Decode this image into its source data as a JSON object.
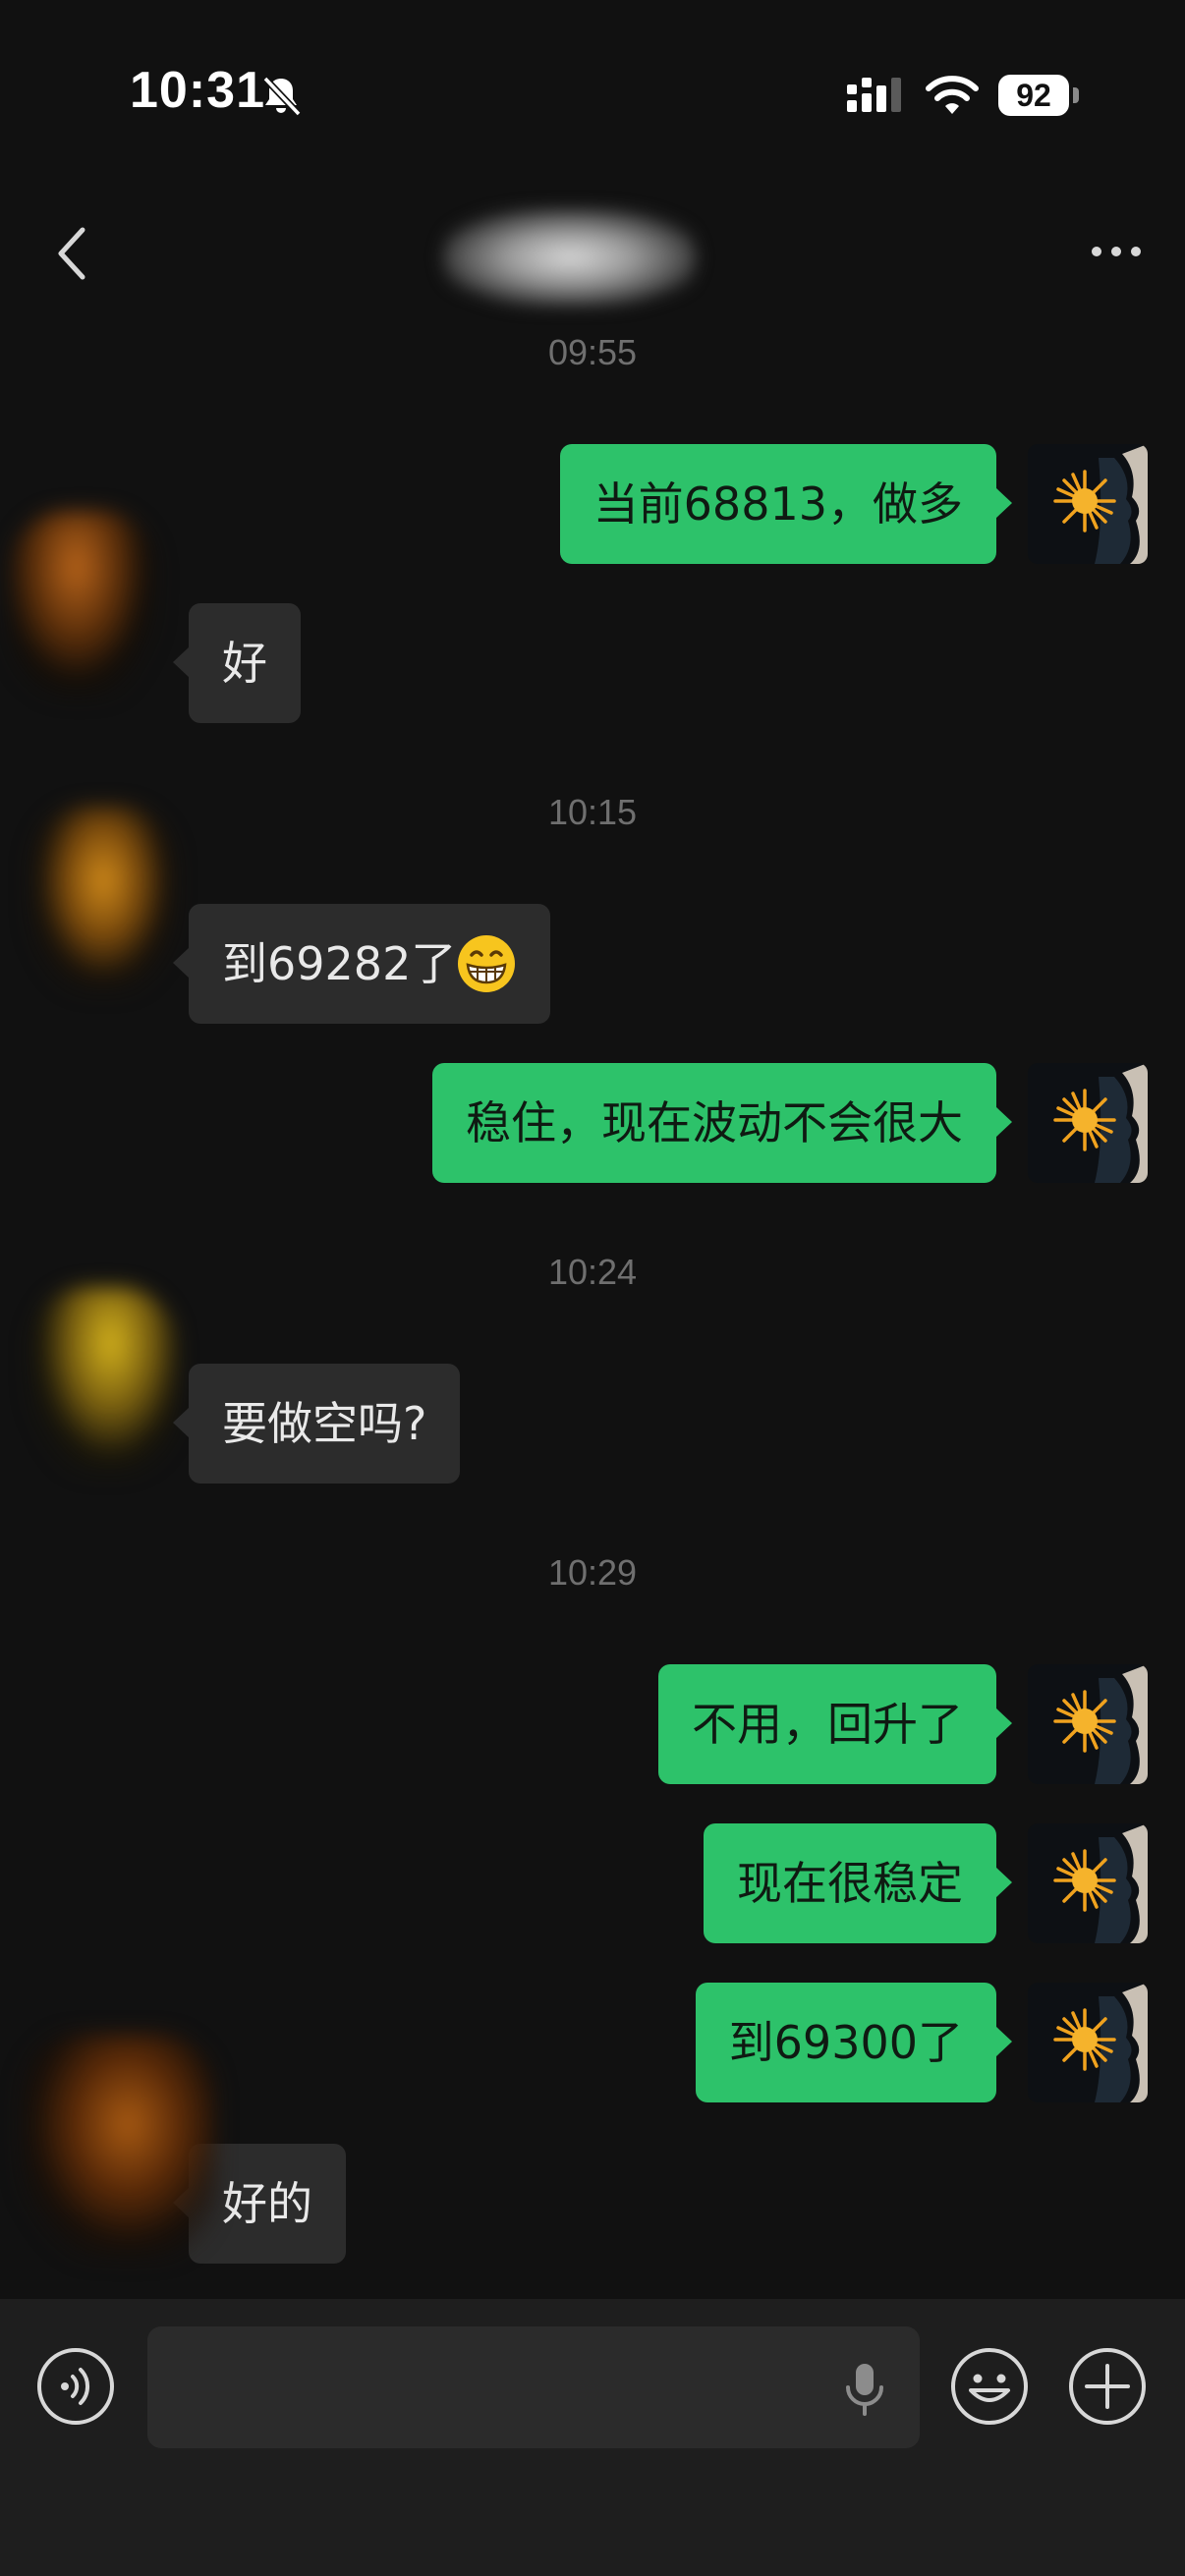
{
  "status_bar": {
    "time": "10:31",
    "battery": "92",
    "icons": [
      "bell-slash-icon",
      "signal-icon",
      "wifi-icon",
      "battery-icon"
    ]
  },
  "nav": {
    "back_icon": "chevron-left-icon",
    "more_icon": "more-dots-icon"
  },
  "colors": {
    "background": "#111111",
    "outgoing_bubble": "#2dc26a",
    "incoming_bubble": "#2c2c2c",
    "timestamp": "#6f6f6f"
  },
  "messages": [
    {
      "type": "time",
      "text": "09:55"
    },
    {
      "type": "out",
      "text": "当前68813，做多"
    },
    {
      "type": "in",
      "text": "好"
    },
    {
      "type": "time",
      "text": "10:15"
    },
    {
      "type": "in",
      "text": "到69282了",
      "emoji": "grinning-face-icon"
    },
    {
      "type": "out",
      "text": "稳住，现在波动不会很大"
    },
    {
      "type": "time",
      "text": "10:24"
    },
    {
      "type": "in",
      "text": "要做空吗?"
    },
    {
      "type": "time",
      "text": "10:29"
    },
    {
      "type": "out",
      "text": "不用，回升了"
    },
    {
      "type": "out",
      "text": "现在很稳定"
    },
    {
      "type": "out",
      "text": "到69300了"
    },
    {
      "type": "in",
      "text": "好的"
    }
  ],
  "input_bar": {
    "value": "",
    "icons": [
      "voice-icon",
      "microphone-icon",
      "emoji-icon",
      "plus-icon"
    ]
  }
}
